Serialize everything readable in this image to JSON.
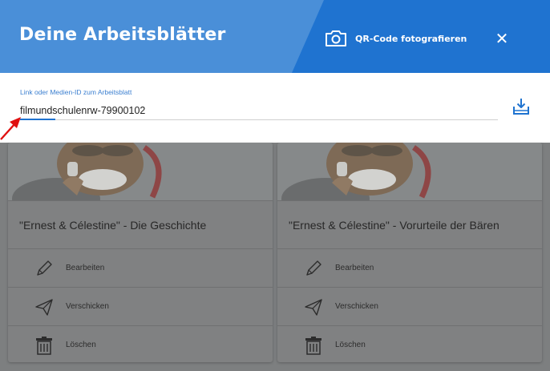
{
  "header": {
    "title": "Deine Arbeitsblätter",
    "qr_button_label": "QR-Code fotografieren",
    "close_label": "✕"
  },
  "input": {
    "label": "Link oder Medien-ID zum Arbeitsblatt",
    "value": "filmundschulenrw-79900102"
  },
  "cards": [
    {
      "title": "\"Ernest & Célestine\" - Die Geschichte",
      "actions": {
        "edit": "Bearbeiten",
        "send": "Verschicken",
        "delete": "Löschen"
      }
    },
    {
      "title": "\"Ernest & Célestine\" - Vorurteile der Bären",
      "actions": {
        "edit": "Bearbeiten",
        "send": "Verschicken",
        "delete": "Löschen"
      }
    }
  ],
  "icons": {
    "camera": "camera-icon",
    "close": "close-icon",
    "download": "download-icon",
    "edit": "pencil-icon",
    "send": "paper-plane-icon",
    "delete": "trash-icon",
    "annotation": "red-arrow-icon"
  },
  "colors": {
    "header_light": "#4a8fd8",
    "header_dark": "#1f73d0",
    "accent": "#1f73d0",
    "overlay": "#7d7f80",
    "annotation_arrow": "#e01010"
  }
}
